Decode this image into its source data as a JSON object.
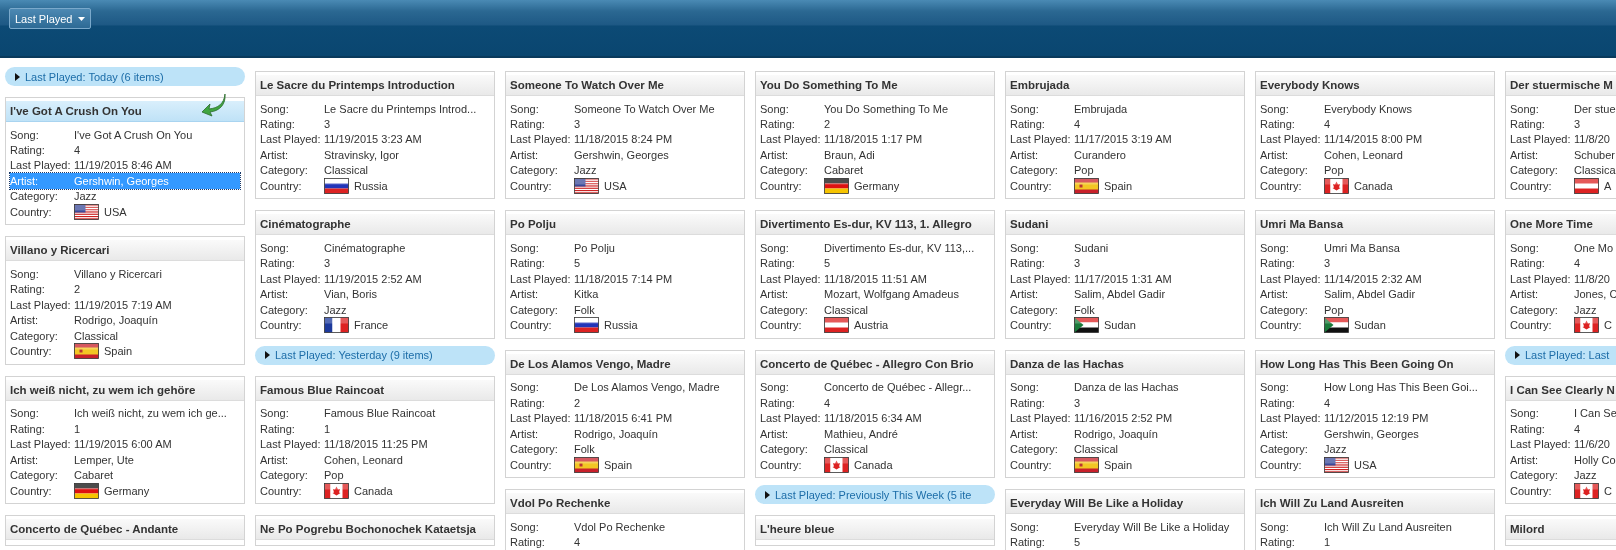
{
  "toolbar": {
    "group_by": "Last Played"
  },
  "columns": [
    [
      {
        "kind": "group",
        "label": "Last Played: Today (6 items)"
      },
      {
        "kind": "card",
        "title": "I've Got A Crush On You",
        "selected": true,
        "rows": [
          {
            "kind": "text",
            "label": "Song:",
            "value": "I've Got A Crush On You",
            "selected": false
          },
          {
            "kind": "text",
            "label": "Rating:",
            "value": "4",
            "selected": false
          },
          {
            "kind": "text",
            "label": "Last Played:",
            "value": "11/19/2015 8:46 AM",
            "selected": false
          },
          {
            "kind": "text",
            "label": "Artist:",
            "value": "Gershwin, Georges",
            "selected": true
          },
          {
            "kind": "text",
            "label": "Category:",
            "value": "Jazz",
            "selected": false
          },
          {
            "kind": "flag_us",
            "label": "Country:",
            "value": "USA",
            "selected": false
          }
        ]
      },
      {
        "kind": "card",
        "title": "Villano y Ricercari",
        "selected": false,
        "rows": [
          {
            "kind": "text",
            "label": "Song:",
            "value": "Villano y Ricercari",
            "selected": false
          },
          {
            "kind": "text",
            "label": "Rating:",
            "value": "2",
            "selected": false
          },
          {
            "kind": "text",
            "label": "Last Played:",
            "value": "11/19/2015 7:19 AM",
            "selected": false
          },
          {
            "kind": "text",
            "label": "Artist:",
            "value": "Rodrigo, Joaquín",
            "selected": false
          },
          {
            "kind": "text",
            "label": "Category:",
            "value": "Classical",
            "selected": false
          },
          {
            "kind": "flag_es",
            "label": "Country:",
            "value": "Spain",
            "selected": false
          }
        ]
      },
      {
        "kind": "card",
        "title": "Ich weiß nicht, zu wem ich gehöre",
        "selected": false,
        "rows": [
          {
            "kind": "text",
            "label": "Song:",
            "value": "Ich weiß nicht, zu wem ich ge...",
            "selected": false
          },
          {
            "kind": "text",
            "label": "Rating:",
            "value": "1",
            "selected": false
          },
          {
            "kind": "text",
            "label": "Last Played:",
            "value": "11/19/2015 6:00 AM",
            "selected": false
          },
          {
            "kind": "text",
            "label": "Artist:",
            "value": "Lemper, Ute",
            "selected": false
          },
          {
            "kind": "text",
            "label": "Category:",
            "value": "Cabaret",
            "selected": false
          },
          {
            "kind": "flag_de",
            "label": "Country:",
            "value": "Germany",
            "selected": false
          }
        ]
      },
      {
        "kind": "card",
        "title": "Concerto de Québec - Andante",
        "selected": false
      }
    ],
    [
      {
        "kind": "card",
        "title": "Le Sacre du Printemps Introduction",
        "selected": false,
        "rows": [
          {
            "kind": "text",
            "label": "Song:",
            "value": "Le Sacre du Printemps Introd...",
            "selected": false
          },
          {
            "kind": "text",
            "label": "Rating:",
            "value": "3",
            "selected": false
          },
          {
            "kind": "text",
            "label": "Last Played:",
            "value": "11/19/2015 3:23 AM",
            "selected": false
          },
          {
            "kind": "text",
            "label": "Artist:",
            "value": "Stravinsky, Igor",
            "selected": false
          },
          {
            "kind": "text",
            "label": "Category:",
            "value": "Classical",
            "selected": false
          },
          {
            "kind": "flag_ru",
            "label": "Country:",
            "value": "Russia",
            "selected": false
          }
        ]
      },
      {
        "kind": "card",
        "title": "Cinématographe",
        "selected": false,
        "rows": [
          {
            "kind": "text",
            "label": "Song:",
            "value": "Cinématographe",
            "selected": false
          },
          {
            "kind": "text",
            "label": "Rating:",
            "value": "3",
            "selected": false
          },
          {
            "kind": "text",
            "label": "Last Played:",
            "value": "11/19/2015 2:52 AM",
            "selected": false
          },
          {
            "kind": "text",
            "label": "Artist:",
            "value": "Vian, Boris",
            "selected": false
          },
          {
            "kind": "text",
            "label": "Category:",
            "value": "Jazz",
            "selected": false
          },
          {
            "kind": "flag_fr",
            "label": "Country:",
            "value": "France",
            "selected": false
          }
        ]
      },
      {
        "kind": "group",
        "label": "Last Played: Yesterday (9 items)"
      },
      {
        "kind": "card",
        "title": "Famous Blue Raincoat",
        "selected": false,
        "rows": [
          {
            "kind": "text",
            "label": "Song:",
            "value": "Famous Blue Raincoat",
            "selected": false
          },
          {
            "kind": "text",
            "label": "Rating:",
            "value": "1",
            "selected": false
          },
          {
            "kind": "text",
            "label": "Last Played:",
            "value": "11/18/2015 11:25 PM",
            "selected": false
          },
          {
            "kind": "text",
            "label": "Artist:",
            "value": "Cohen, Leonard",
            "selected": false
          },
          {
            "kind": "text",
            "label": "Category:",
            "value": "Pop",
            "selected": false
          },
          {
            "kind": "flag_ca",
            "label": "Country:",
            "value": "Canada",
            "selected": false
          }
        ]
      },
      {
        "kind": "card",
        "title": "Ne Po Pogrebu Bochonochek Kataetsja",
        "selected": false
      }
    ],
    [
      {
        "kind": "card",
        "title": "Someone To Watch Over Me",
        "selected": false,
        "rows": [
          {
            "kind": "text",
            "label": "Song:",
            "value": "Someone To Watch Over Me",
            "selected": false
          },
          {
            "kind": "text",
            "label": "Rating:",
            "value": "3",
            "selected": false
          },
          {
            "kind": "text",
            "label": "Last Played:",
            "value": "11/18/2015 8:24 PM",
            "selected": false
          },
          {
            "kind": "text",
            "label": "Artist:",
            "value": "Gershwin, Georges",
            "selected": false
          },
          {
            "kind": "text",
            "label": "Category:",
            "value": "Jazz",
            "selected": false
          },
          {
            "kind": "flag_us",
            "label": "Country:",
            "value": "USA",
            "selected": false
          }
        ]
      },
      {
        "kind": "card",
        "title": "Po Polju",
        "selected": false,
        "rows": [
          {
            "kind": "text",
            "label": "Song:",
            "value": "Po Polju",
            "selected": false
          },
          {
            "kind": "text",
            "label": "Rating:",
            "value": "5",
            "selected": false
          },
          {
            "kind": "text",
            "label": "Last Played:",
            "value": "11/18/2015 7:14 PM",
            "selected": false
          },
          {
            "kind": "text",
            "label": "Artist:",
            "value": "Kitka",
            "selected": false
          },
          {
            "kind": "text",
            "label": "Category:",
            "value": "Folk",
            "selected": false
          },
          {
            "kind": "flag_ru",
            "label": "Country:",
            "value": "Russia",
            "selected": false
          }
        ]
      },
      {
        "kind": "card",
        "title": "De Los Alamos Vengo, Madre",
        "selected": false,
        "rows": [
          {
            "kind": "text",
            "label": "Song:",
            "value": "De Los Alamos Vengo, Madre",
            "selected": false
          },
          {
            "kind": "text",
            "label": "Rating:",
            "value": "2",
            "selected": false
          },
          {
            "kind": "text",
            "label": "Last Played:",
            "value": "11/18/2015 6:41 PM",
            "selected": false
          },
          {
            "kind": "text",
            "label": "Artist:",
            "value": "Rodrigo, Joaquín",
            "selected": false
          },
          {
            "kind": "text",
            "label": "Category:",
            "value": "Folk",
            "selected": false
          },
          {
            "kind": "flag_es",
            "label": "Country:",
            "value": "Spain",
            "selected": false
          }
        ]
      },
      {
        "kind": "card",
        "title": "Vdol Po Rechenke",
        "selected": false,
        "rows": [
          {
            "kind": "text",
            "label": "Song:",
            "value": "Vdol Po Rechenke",
            "selected": false
          },
          {
            "kind": "text",
            "label": "Rating:",
            "value": "4",
            "selected": false
          }
        ]
      }
    ],
    [
      {
        "kind": "card",
        "title": "You Do Something To Me",
        "selected": false,
        "rows": [
          {
            "kind": "text",
            "label": "Song:",
            "value": "You Do Something To Me",
            "selected": false
          },
          {
            "kind": "text",
            "label": "Rating:",
            "value": "2",
            "selected": false
          },
          {
            "kind": "text",
            "label": "Last Played:",
            "value": "11/18/2015 1:17 PM",
            "selected": false
          },
          {
            "kind": "text",
            "label": "Artist:",
            "value": "Braun, Adi",
            "selected": false
          },
          {
            "kind": "text",
            "label": "Category:",
            "value": "Cabaret",
            "selected": false
          },
          {
            "kind": "flag_de",
            "label": "Country:",
            "value": "Germany",
            "selected": false
          }
        ]
      },
      {
        "kind": "card",
        "title": "Divertimento Es-dur, KV 113, 1. Allegro",
        "selected": false,
        "rows": [
          {
            "kind": "text",
            "label": "Song:",
            "value": "Divertimento Es-dur, KV 113,...",
            "selected": false
          },
          {
            "kind": "text",
            "label": "Rating:",
            "value": "5",
            "selected": false
          },
          {
            "kind": "text",
            "label": "Last Played:",
            "value": "11/18/2015 11:51 AM",
            "selected": false
          },
          {
            "kind": "text",
            "label": "Artist:",
            "value": "Mozart, Wolfgang Amadeus",
            "selected": false
          },
          {
            "kind": "text",
            "label": "Category:",
            "value": "Classical",
            "selected": false
          },
          {
            "kind": "flag_at",
            "label": "Country:",
            "value": "Austria",
            "selected": false
          }
        ]
      },
      {
        "kind": "card",
        "title": "Concerto de Québec - Allegro Con Brio",
        "selected": false,
        "rows": [
          {
            "kind": "text",
            "label": "Song:",
            "value": "Concerto de Québec - Allegr...",
            "selected": false
          },
          {
            "kind": "text",
            "label": "Rating:",
            "value": "4",
            "selected": false
          },
          {
            "kind": "text",
            "label": "Last Played:",
            "value": "11/18/2015 6:34 AM",
            "selected": false
          },
          {
            "kind": "text",
            "label": "Artist:",
            "value": "Mathieu, André",
            "selected": false
          },
          {
            "kind": "text",
            "label": "Category:",
            "value": "Classical",
            "selected": false
          },
          {
            "kind": "flag_ca",
            "label": "Country:",
            "value": "Canada",
            "selected": false
          }
        ]
      },
      {
        "kind": "group",
        "label": "Last Played: Previously This Week (5 ite"
      },
      {
        "kind": "card",
        "title": "L'heure bleue",
        "selected": false
      }
    ],
    [
      {
        "kind": "card",
        "title": "Embrujada",
        "selected": false,
        "rows": [
          {
            "kind": "text",
            "label": "Song:",
            "value": "Embrujada",
            "selected": false
          },
          {
            "kind": "text",
            "label": "Rating:",
            "value": "4",
            "selected": false
          },
          {
            "kind": "text",
            "label": "Last Played:",
            "value": "11/17/2015 3:19 AM",
            "selected": false
          },
          {
            "kind": "text",
            "label": "Artist:",
            "value": "Curandero",
            "selected": false
          },
          {
            "kind": "text",
            "label": "Category:",
            "value": "Pop",
            "selected": false
          },
          {
            "kind": "flag_es",
            "label": "Country:",
            "value": "Spain",
            "selected": false
          }
        ]
      },
      {
        "kind": "card",
        "title": "Sudani",
        "selected": false,
        "rows": [
          {
            "kind": "text",
            "label": "Song:",
            "value": "Sudani",
            "selected": false
          },
          {
            "kind": "text",
            "label": "Rating:",
            "value": "3",
            "selected": false
          },
          {
            "kind": "text",
            "label": "Last Played:",
            "value": "11/17/2015 1:31 AM",
            "selected": false
          },
          {
            "kind": "text",
            "label": "Artist:",
            "value": "Salim, Abdel Gadir",
            "selected": false
          },
          {
            "kind": "text",
            "label": "Category:",
            "value": "Folk",
            "selected": false
          },
          {
            "kind": "flag_sd",
            "label": "Country:",
            "value": "Sudan",
            "selected": false
          }
        ]
      },
      {
        "kind": "card",
        "title": "Danza de las Hachas",
        "selected": false,
        "rows": [
          {
            "kind": "text",
            "label": "Song:",
            "value": "Danza de las Hachas",
            "selected": false
          },
          {
            "kind": "text",
            "label": "Rating:",
            "value": "3",
            "selected": false
          },
          {
            "kind": "text",
            "label": "Last Played:",
            "value": "11/16/2015 2:52 PM",
            "selected": false
          },
          {
            "kind": "text",
            "label": "Artist:",
            "value": "Rodrigo, Joaquín",
            "selected": false
          },
          {
            "kind": "text",
            "label": "Category:",
            "value": "Classical",
            "selected": false
          },
          {
            "kind": "flag_es",
            "label": "Country:",
            "value": "Spain",
            "selected": false
          }
        ]
      },
      {
        "kind": "card",
        "title": "Everyday Will Be Like a Holiday",
        "selected": false,
        "rows": [
          {
            "kind": "text",
            "label": "Song:",
            "value": "Everyday Will Be Like a Holiday",
            "selected": false
          },
          {
            "kind": "text",
            "label": "Rating:",
            "value": "5",
            "selected": false
          }
        ]
      }
    ],
    [
      {
        "kind": "card",
        "title": "Everybody Knows",
        "selected": false,
        "rows": [
          {
            "kind": "text",
            "label": "Song:",
            "value": "Everybody Knows",
            "selected": false
          },
          {
            "kind": "text",
            "label": "Rating:",
            "value": "4",
            "selected": false
          },
          {
            "kind": "text",
            "label": "Last Played:",
            "value": "11/14/2015 8:00 PM",
            "selected": false
          },
          {
            "kind": "text",
            "label": "Artist:",
            "value": "Cohen, Leonard",
            "selected": false
          },
          {
            "kind": "text",
            "label": "Category:",
            "value": "Pop",
            "selected": false
          },
          {
            "kind": "flag_ca",
            "label": "Country:",
            "value": "Canada",
            "selected": false
          }
        ]
      },
      {
        "kind": "card",
        "title": "Umri Ma Bansa",
        "selected": false,
        "rows": [
          {
            "kind": "text",
            "label": "Song:",
            "value": "Umri Ma Bansa",
            "selected": false
          },
          {
            "kind": "text",
            "label": "Rating:",
            "value": "3",
            "selected": false
          },
          {
            "kind": "text",
            "label": "Last Played:",
            "value": "11/14/2015 2:32 AM",
            "selected": false
          },
          {
            "kind": "text",
            "label": "Artist:",
            "value": "Salim, Abdel Gadir",
            "selected": false
          },
          {
            "kind": "text",
            "label": "Category:",
            "value": "Pop",
            "selected": false
          },
          {
            "kind": "flag_sd",
            "label": "Country:",
            "value": "Sudan",
            "selected": false
          }
        ]
      },
      {
        "kind": "card",
        "title": "How Long Has This Been Going On",
        "selected": false,
        "rows": [
          {
            "kind": "text",
            "label": "Song:",
            "value": "How Long Has This Been Goi...",
            "selected": false
          },
          {
            "kind": "text",
            "label": "Rating:",
            "value": "4",
            "selected": false
          },
          {
            "kind": "text",
            "label": "Last Played:",
            "value": "11/12/2015 12:19 PM",
            "selected": false
          },
          {
            "kind": "text",
            "label": "Artist:",
            "value": "Gershwin, Georges",
            "selected": false
          },
          {
            "kind": "text",
            "label": "Category:",
            "value": "Jazz",
            "selected": false
          },
          {
            "kind": "flag_us",
            "label": "Country:",
            "value": "USA",
            "selected": false
          }
        ]
      },
      {
        "kind": "card",
        "title": "Ich Will Zu Land Ausreiten",
        "selected": false,
        "rows": [
          {
            "kind": "text",
            "label": "Song:",
            "value": "Ich Will Zu Land Ausreiten",
            "selected": false
          },
          {
            "kind": "text",
            "label": "Rating:",
            "value": "1",
            "selected": false
          }
        ]
      }
    ],
    [
      {
        "kind": "card",
        "title": "Der stuermische M",
        "selected": false,
        "rows": [
          {
            "kind": "text",
            "label": "Song:",
            "value": "Der stue",
            "selected": false
          },
          {
            "kind": "text",
            "label": "Rating:",
            "value": "3",
            "selected": false
          },
          {
            "kind": "text",
            "label": "Last Played:",
            "value": "11/8/20",
            "selected": false
          },
          {
            "kind": "text",
            "label": "Artist:",
            "value": "Schuber",
            "selected": false
          },
          {
            "kind": "text",
            "label": "Category:",
            "value": "Classica",
            "selected": false
          },
          {
            "kind": "flag_at",
            "label": "Country:",
            "value": "A",
            "selected": false
          }
        ]
      },
      {
        "kind": "card",
        "title": "One More Time",
        "selected": false,
        "rows": [
          {
            "kind": "text",
            "label": "Song:",
            "value": "One Mo",
            "selected": false
          },
          {
            "kind": "text",
            "label": "Rating:",
            "value": "4",
            "selected": false
          },
          {
            "kind": "text",
            "label": "Last Played:",
            "value": "11/8/20",
            "selected": false
          },
          {
            "kind": "text",
            "label": "Artist:",
            "value": "Jones, C",
            "selected": false
          },
          {
            "kind": "text",
            "label": "Category:",
            "value": "Jazz",
            "selected": false
          },
          {
            "kind": "flag_ca",
            "label": "Country:",
            "value": "C",
            "selected": false
          }
        ]
      },
      {
        "kind": "group",
        "label": "Last Played: Last"
      },
      {
        "kind": "card",
        "title": "I Can See Clearly N",
        "selected": false,
        "rows": [
          {
            "kind": "text",
            "label": "Song:",
            "value": "I Can Se",
            "selected": false
          },
          {
            "kind": "text",
            "label": "Rating:",
            "value": "4",
            "selected": false
          },
          {
            "kind": "text",
            "label": "Last Played:",
            "value": "11/6/20",
            "selected": false
          },
          {
            "kind": "text",
            "label": "Artist:",
            "value": "Holly Co",
            "selected": false
          },
          {
            "kind": "text",
            "label": "Category:",
            "value": "Jazz",
            "selected": false
          },
          {
            "kind": "flag_ca",
            "label": "Country:",
            "value": "C",
            "selected": false
          }
        ]
      },
      {
        "kind": "card",
        "title": "Milord",
        "selected": false
      }
    ]
  ]
}
